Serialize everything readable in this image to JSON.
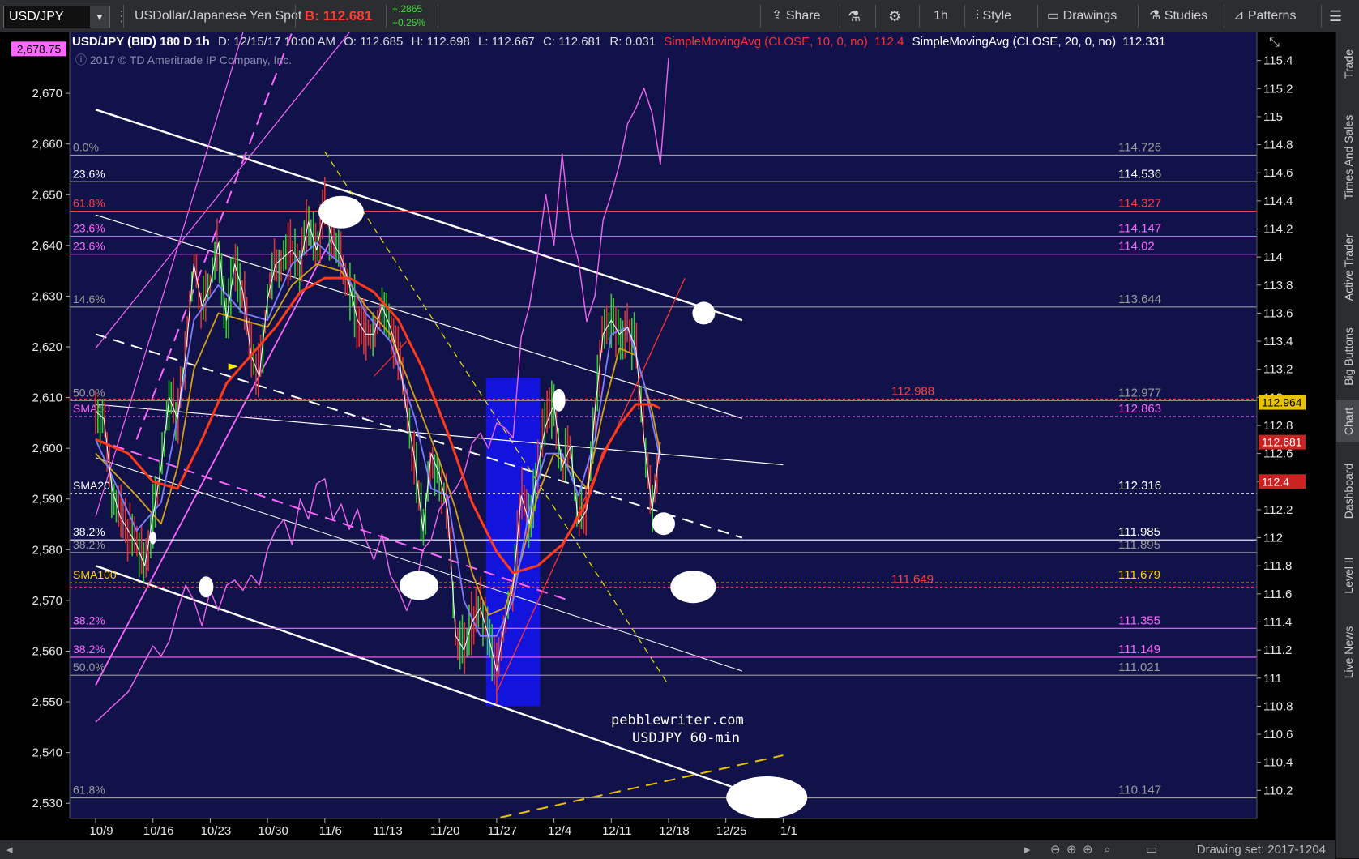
{
  "toolbar": {
    "symbol": "USD/JPY",
    "description": "USDollar/Japanese Yen Spot",
    "bid": "B: 112.681",
    "change": "+.2865",
    "change_pct": "+0.25%",
    "share": "Share",
    "interval": "1h",
    "style": "Style",
    "drawings": "Drawings",
    "studies": "Studies",
    "patterns": "Patterns"
  },
  "rail": [
    "Trade",
    "Times And Sales",
    "Active Trader",
    "Big Buttons",
    "Chart",
    "Dashboard",
    "Level II",
    "Live News"
  ],
  "header": {
    "title": "USD/JPY (BID) 180 D 1h",
    "date": "D: 12/15/17 10:00 AM",
    "open": "O: 112.685",
    "high": "H: 112.698",
    "low": "L: 112.667",
    "close": "C: 112.681",
    "range": "R: 0.031",
    "sma10": "SimpleMovingAvg (CLOSE, 10, 0, no)",
    "sma10_val": "112.4",
    "sma20": "SimpleMovingAvg (CLOSE, 20, 0, no)",
    "sma20_val": "112.331",
    "copyright": "2017 © TD Ameritrade IP Company, Inc."
  },
  "watermark": [
    "pebblewriter.com",
    "USDJPY 60-min"
  ],
  "status": {
    "drawing_set": "Drawing set: 2017-1204"
  },
  "chart_data": {
    "type": "line",
    "title": "USD/JPY (BID) 180 D 1h",
    "x_ticks": [
      "10/9",
      "10/16",
      "10/23",
      "10/30",
      "11/6",
      "11/13",
      "11/20",
      "11/27",
      "12/4",
      "12/11",
      "12/18",
      "12/25",
      "1/1"
    ],
    "x_tick_pos": [
      0,
      7,
      14,
      21,
      28,
      35,
      42,
      49,
      56,
      63,
      70,
      77,
      84
    ],
    "left_axis": {
      "range": [
        2527,
        2682
      ],
      "ticks": [
        2530,
        2540,
        2550,
        2560,
        2570,
        2580,
        2590,
        2600,
        2610,
        2620,
        2630,
        2640,
        2650,
        2660,
        2670
      ],
      "label_box": "2,678.75"
    },
    "right_axis": {
      "range": [
        110.0,
        115.6
      ],
      "ticks": [
        110.2,
        110.4,
        110.6,
        110.8,
        111,
        111.2,
        111.4,
        111.6,
        111.8,
        112,
        112.2,
        112.4,
        112.6,
        112.8,
        113,
        113.2,
        113.4,
        113.6,
        113.8,
        114,
        114.2,
        114.4,
        114.6,
        114.8,
        115,
        115.2,
        115.4
      ]
    },
    "usdjpy_close": [
      [
        0,
        112.9
      ],
      [
        1,
        112.85
      ],
      [
        2,
        112.35
      ],
      [
        3,
        112.15
      ],
      [
        4,
        112.05
      ],
      [
        5,
        111.95
      ],
      [
        6,
        111.8
      ],
      [
        7,
        112.15
      ],
      [
        8,
        112.5
      ],
      [
        9,
        113.0
      ],
      [
        10,
        112.85
      ],
      [
        11,
        113.3
      ],
      [
        12,
        113.95
      ],
      [
        13,
        113.65
      ],
      [
        14,
        113.8
      ],
      [
        15,
        114.1
      ],
      [
        16,
        113.55
      ],
      [
        17,
        113.95
      ],
      [
        18,
        113.75
      ],
      [
        19,
        113.3
      ],
      [
        20,
        113.15
      ],
      [
        21,
        113.7
      ],
      [
        22,
        113.95
      ],
      [
        23,
        114.0
      ],
      [
        24,
        114.05
      ],
      [
        25,
        113.95
      ],
      [
        26,
        114.25
      ],
      [
        27,
        114.05
      ],
      [
        28,
        114.35
      ],
      [
        29,
        114.1
      ],
      [
        30,
        114.0
      ],
      [
        31,
        113.8
      ],
      [
        32,
        113.55
      ],
      [
        33,
        113.45
      ],
      [
        34,
        113.45
      ],
      [
        35,
        113.65
      ],
      [
        36,
        113.5
      ],
      [
        37,
        113.3
      ],
      [
        38,
        112.9
      ],
      [
        39,
        112.55
      ],
      [
        40,
        112.05
      ],
      [
        41,
        112.6
      ],
      [
        42,
        112.45
      ],
      [
        43,
        112.2
      ],
      [
        44,
        111.3
      ],
      [
        45,
        111.2
      ],
      [
        46,
        111.4
      ],
      [
        47,
        111.5
      ],
      [
        48,
        111.3
      ],
      [
        49,
        111.05
      ],
      [
        50,
        111.4
      ],
      [
        51,
        111.65
      ],
      [
        52,
        112.3
      ],
      [
        53,
        112.1
      ],
      [
        54,
        112.5
      ],
      [
        55,
        112.8
      ],
      [
        56,
        112.95
      ],
      [
        57,
        112.5
      ],
      [
        58,
        112.65
      ],
      [
        59,
        112.1
      ],
      [
        60,
        112.2
      ],
      [
        61,
        112.9
      ],
      [
        62,
        113.45
      ],
      [
        63,
        113.55
      ],
      [
        64,
        113.45
      ],
      [
        65,
        113.5
      ],
      [
        66,
        113.35
      ],
      [
        67,
        112.7
      ],
      [
        68,
        112.2
      ],
      [
        69,
        112.68
      ]
    ],
    "spx_line": [
      [
        0,
        2546
      ],
      [
        2,
        2549
      ],
      [
        4,
        2552
      ],
      [
        6,
        2558
      ],
      [
        7,
        2561
      ],
      [
        8,
        2559
      ],
      [
        9,
        2562
      ],
      [
        10,
        2568
      ],
      [
        11,
        2573
      ],
      [
        12,
        2570
      ],
      [
        13,
        2565
      ],
      [
        14,
        2572
      ],
      [
        15,
        2568
      ],
      [
        16,
        2573
      ],
      [
        17,
        2574
      ],
      [
        18,
        2572
      ],
      [
        19,
        2575
      ],
      [
        20,
        2573
      ],
      [
        21,
        2580
      ],
      [
        22,
        2584
      ],
      [
        23,
        2586
      ],
      [
        24,
        2581
      ],
      [
        25,
        2590
      ],
      [
        26,
        2586
      ],
      [
        27,
        2593
      ],
      [
        28,
        2594
      ],
      [
        29,
        2586
      ],
      [
        30,
        2589
      ],
      [
        31,
        2584
      ],
      [
        32,
        2588
      ],
      [
        33,
        2582
      ],
      [
        34,
        2578
      ],
      [
        35,
        2583
      ],
      [
        36,
        2575
      ],
      [
        37,
        2572
      ],
      [
        38,
        2568
      ],
      [
        39,
        2572
      ],
      [
        40,
        2580
      ],
      [
        41,
        2582
      ],
      [
        42,
        2588
      ],
      [
        43,
        2590
      ],
      [
        44,
        2592
      ],
      [
        45,
        2595
      ],
      [
        46,
        2601
      ],
      [
        47,
        2603
      ],
      [
        48,
        2600
      ],
      [
        49,
        2605
      ],
      [
        50,
        2604
      ],
      [
        51,
        2602
      ],
      [
        52,
        2622
      ],
      [
        53,
        2628
      ],
      [
        54,
        2638
      ],
      [
        55,
        2650
      ],
      [
        56,
        2640
      ],
      [
        57,
        2658
      ],
      [
        58,
        2643
      ],
      [
        59,
        2637
      ],
      [
        60,
        2625
      ],
      [
        61,
        2630
      ],
      [
        62,
        2645
      ],
      [
        63,
        2650
      ],
      [
        64,
        2656
      ],
      [
        65,
        2664
      ],
      [
        66,
        2667
      ],
      [
        67,
        2671
      ],
      [
        68,
        2666
      ],
      [
        69,
        2656
      ],
      [
        70,
        2677
      ]
    ],
    "sma10": [
      [
        0,
        112.7
      ],
      [
        5,
        112.05
      ],
      [
        8,
        112.25
      ],
      [
        10,
        112.85
      ],
      [
        12,
        113.55
      ],
      [
        15,
        113.8
      ],
      [
        18,
        113.6
      ],
      [
        21,
        113.55
      ],
      [
        24,
        113.95
      ],
      [
        27,
        114.1
      ],
      [
        30,
        113.95
      ],
      [
        33,
        113.6
      ],
      [
        36,
        113.4
      ],
      [
        39,
        112.85
      ],
      [
        41,
        112.35
      ],
      [
        43,
        112.3
      ],
      [
        45,
        111.55
      ],
      [
        47,
        111.3
      ],
      [
        49,
        111.3
      ],
      [
        51,
        111.55
      ],
      [
        53,
        112.2
      ],
      [
        55,
        112.6
      ],
      [
        57,
        112.6
      ],
      [
        59,
        112.3
      ],
      [
        61,
        112.7
      ],
      [
        63,
        113.45
      ],
      [
        65,
        113.5
      ],
      [
        67,
        113.1
      ],
      [
        69,
        112.55
      ]
    ],
    "sma20": [
      [
        0,
        112.6
      ],
      [
        5,
        112.3
      ],
      [
        8,
        112.1
      ],
      [
        10,
        112.5
      ],
      [
        12,
        113.2
      ],
      [
        15,
        113.6
      ],
      [
        18,
        113.55
      ],
      [
        21,
        113.5
      ],
      [
        24,
        113.8
      ],
      [
        27,
        113.95
      ],
      [
        30,
        113.9
      ],
      [
        33,
        113.65
      ],
      [
        36,
        113.45
      ],
      [
        39,
        113.0
      ],
      [
        42,
        112.55
      ],
      [
        44,
        112.2
      ],
      [
        46,
        111.75
      ],
      [
        48,
        111.45
      ],
      [
        50,
        111.5
      ],
      [
        52,
        111.85
      ],
      [
        54,
        112.3
      ],
      [
        56,
        112.6
      ],
      [
        58,
        112.5
      ],
      [
        60,
        112.35
      ],
      [
        62,
        112.9
      ],
      [
        64,
        113.35
      ],
      [
        66,
        113.3
      ],
      [
        68,
        112.9
      ],
      [
        69,
        112.6
      ]
    ],
    "sma50": [
      [
        0,
        112.7
      ],
      [
        4,
        112.6
      ],
      [
        7,
        112.4
      ],
      [
        10,
        112.35
      ],
      [
        13,
        112.7
      ],
      [
        16,
        113.1
      ],
      [
        19,
        113.3
      ],
      [
        22,
        113.5
      ],
      [
        25,
        113.75
      ],
      [
        28,
        113.85
      ],
      [
        31,
        113.85
      ],
      [
        34,
        113.75
      ],
      [
        37,
        113.55
      ],
      [
        40,
        113.2
      ],
      [
        43,
        112.75
      ],
      [
        46,
        112.25
      ],
      [
        49,
        111.9
      ],
      [
        51,
        111.75
      ],
      [
        54,
        111.8
      ],
      [
        57,
        111.95
      ],
      [
        60,
        112.25
      ],
      [
        62,
        112.6
      ],
      [
        64,
        112.8
      ],
      [
        66,
        112.95
      ],
      [
        68,
        112.95
      ],
      [
        69,
        112.92
      ]
    ],
    "levels": [
      {
        "y": 114.726,
        "label": "0.0%",
        "right": "114.726",
        "color": "#9a9a9a"
      },
      {
        "y": 114.536,
        "label": "23.6%",
        "right": "114.536",
        "color": "#ffffff"
      },
      {
        "y": 114.327,
        "label": "61.8%",
        "right": "114.327",
        "color": "#ff4040"
      },
      {
        "y": 114.147,
        "label": "23.6%",
        "right": "114.147",
        "color": "#ff66ff"
      },
      {
        "y": 114.02,
        "label": "23.6%",
        "right": "114.02",
        "color": "#ff66ff"
      },
      {
        "y": 113.644,
        "label": "14.6%",
        "right": "113.644",
        "color": "#9a9a9a"
      },
      {
        "y": 112.977,
        "label": "50.0%",
        "right": "112.977",
        "color": "#9a9a9a"
      },
      {
        "y": 112.988,
        "label": "",
        "right": "112.988",
        "color": "#ff4040"
      },
      {
        "y": 112.863,
        "label": "SMA50",
        "right": "112.863",
        "color": "#ff66ff"
      },
      {
        "y": 112.316,
        "label": "SMA20",
        "right": "112.316",
        "color": "#ffffff"
      },
      {
        "y": 111.985,
        "label": "38.2%",
        "right": "111.985",
        "color": "#ffffff"
      },
      {
        "y": 111.895,
        "label": "38.2%",
        "right": "111.895",
        "color": "#9a9a9a"
      },
      {
        "y": 111.679,
        "label": "SMA100",
        "right": "111.679",
        "color": "#ffd700"
      },
      {
        "y": 111.649,
        "label": "",
        "right": "111.649",
        "color": "#ff4040"
      },
      {
        "y": 111.355,
        "label": "38.2%",
        "right": "111.355",
        "color": "#ff66ff"
      },
      {
        "y": 111.149,
        "label": "38.2%",
        "right": "111.149",
        "color": "#ff66ff"
      },
      {
        "y": 111.021,
        "label": "50.0%",
        "right": "111.021",
        "color": "#9a9a9a"
      },
      {
        "y": 110.147,
        "label": "61.8%",
        "right": "110.147",
        "color": "#9a9a9a"
      }
    ],
    "price_tags": [
      {
        "y": 112.964,
        "text": "112.964",
        "bg": "#e8c200",
        "fg": "#000"
      },
      {
        "y": 112.681,
        "text": "112.681",
        "bg": "#cc2222",
        "fg": "#fff"
      },
      {
        "y": 112.4,
        "text": "112.4",
        "bg": "#cc2222",
        "fg": "#fff"
      }
    ],
    "blue_box": {
      "x0": 47.7,
      "x1": 54.3,
      "y0": 110.8,
      "y1": 113.14
    }
  }
}
